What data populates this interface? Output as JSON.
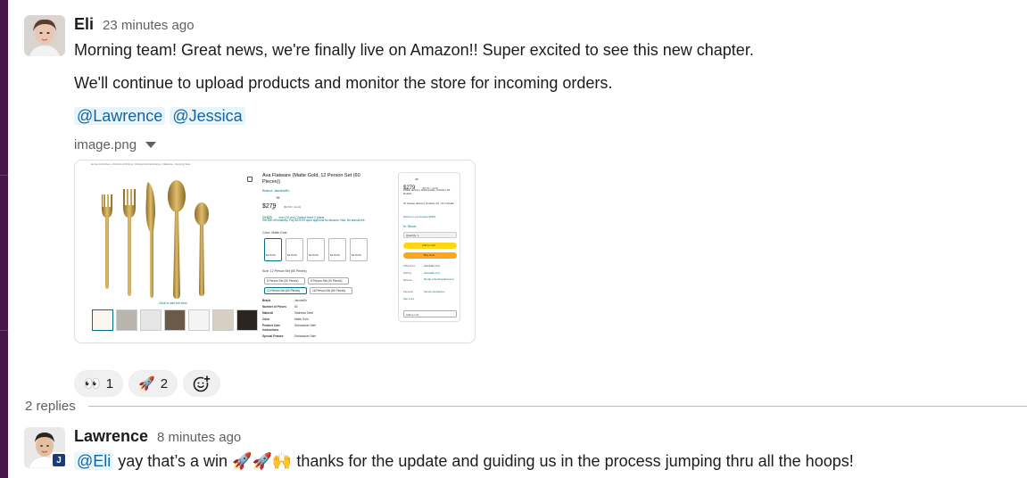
{
  "message": {
    "author": "Eli",
    "time": "23 minutes ago",
    "lines": [
      "Morning team! Great news, we're finally live on Amazon!! Super excited to see this new chapter.",
      "We'll continue to upload products and monitor the store for incoming orders."
    ],
    "mentions": [
      "@Lawrence",
      "@Jessica"
    ],
    "attachment": {
      "filename": "image.png",
      "product": {
        "breadcrumb": "Home & Kitchen › Kitchen & Dining › Dining & Entertaining › Flatware › Serving Sets",
        "title": "Ava Flatware (Matte Gold, 12 Person Set (60 Pieces))",
        "brand": "Brand: JacobsEn",
        "price": "$279",
        "price_cents": "99",
        "unit_price": "($3.69 / count)",
        "sub_price": "Or $29",
        "sub_price_cents": "88",
        "sub_price_note": "/mo (10 mo). Select from 2 plans",
        "promo": "Get $50 off instantly: Pay $229.99 upon approval for Amazon Visa. No annual fee.",
        "color_label": "Color: Matte Gold",
        "variants": [
          "$279.00",
          "$279.00",
          "$279.00",
          "$279.00",
          "$279.00"
        ],
        "size_label": "Size: 12 Person Set (60 Pieces)",
        "sizes": [
          "8 Person Set (30 Pieces)",
          "8 Person Set (40 Pieces)",
          "12 Person Set (60 Pieces)",
          "16 Person Set (80 Pieces)"
        ],
        "specs": [
          [
            "Brand",
            "JacobsEn"
          ],
          [
            "Number of Pieces",
            "60"
          ],
          [
            "Material",
            "Stainless Steel"
          ],
          [
            "Color",
            "Matte Gold"
          ],
          [
            "Product Care Instructions",
            "Dishwasher Safe"
          ],
          [
            "Special Feature",
            "Dishwasher Safe"
          ]
        ],
        "click_full_view": "Click to see full view",
        "buy_box": {
          "price": "$279",
          "price_cents": "99",
          "unit": "($3.69 / count)",
          "delivery": "FREE delivery Wednesday, October 29. Details",
          "fastest": "Or fastest delivery October 23 - 24. Details",
          "deliver_to": "Deliver to Los Angeles 90001",
          "stock": "In Stock",
          "quantity": "Quantity: 1",
          "add_to_cart": "Add to Cart",
          "buy_now": "Buy Now",
          "ships_from_label": "Ships from",
          "ships_from": "JacobsEn LLC",
          "sold_by_label": "Sold by",
          "sold_by": "JacobsEn LLC",
          "returns_label": "Returns",
          "returns": "30-day refund/replacement",
          "payment_label": "Payment",
          "payment": "Secure transaction",
          "see_more": "See more",
          "add_to_list": "Add to List"
        }
      }
    },
    "reactions": [
      {
        "emoji": "👀",
        "count": "1"
      },
      {
        "emoji": "🚀",
        "count": "2"
      }
    ]
  },
  "thread": {
    "replies_label": "2 replies"
  },
  "reply": {
    "author": "Lawrence",
    "time": "8 minutes ago",
    "mention": "@Eli",
    "text_before": "yay that’s a win",
    "emojis": "🚀🚀🙌",
    "text_after": "thanks for the update and guiding us in the process jumping thru all the hoops!",
    "badge": "J"
  },
  "colors": {
    "mention_bg": "#e8f5fa",
    "mention_text": "#1264a3",
    "divider": "#e5a4b9",
    "sidebar": "#4a154b",
    "gold": "#c9a24a",
    "add_to_cart": "#ffd814",
    "buy_now": "#ffa41c"
  }
}
